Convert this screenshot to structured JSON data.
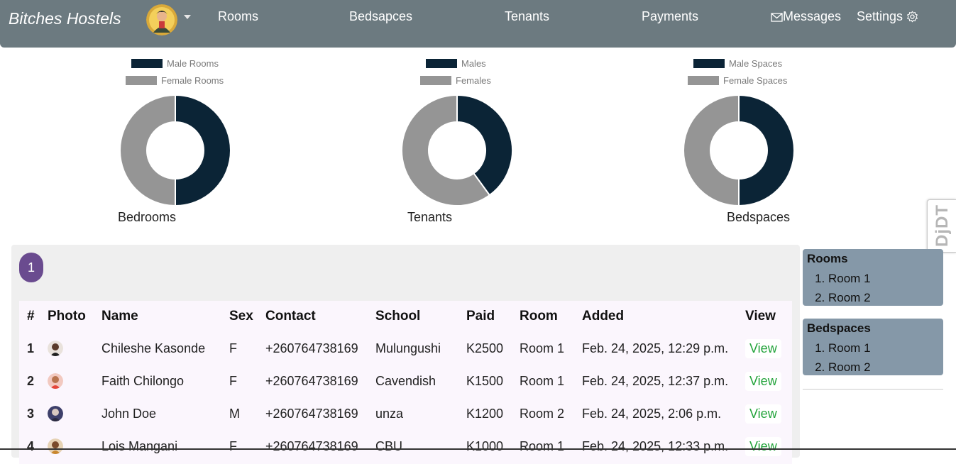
{
  "navbar": {
    "brand": "Bitches Hostels",
    "links": {
      "rooms": "Rooms",
      "bedspaces": "Bedsapces",
      "tenants": "Tenants",
      "payments": "Payments",
      "messages": "Messages",
      "settings": "Settings"
    }
  },
  "charts": [
    {
      "caption": "Bedrooms",
      "legend": [
        "Male Rooms",
        "Female Rooms"
      ],
      "values": [
        50,
        50
      ],
      "colors": [
        "#0b2436",
        "#959595"
      ]
    },
    {
      "caption": "Tenants",
      "legend": [
        "Males",
        "Females"
      ],
      "values": [
        40,
        60
      ],
      "colors": [
        "#0b2436",
        "#959595"
      ]
    },
    {
      "caption": "Bedspaces",
      "legend": [
        "Male Spaces",
        "Female Spaces"
      ],
      "values": [
        50,
        50
      ],
      "colors": [
        "#0b2436",
        "#959595"
      ]
    }
  ],
  "debug_toolbar": {
    "label": "DjDT"
  },
  "pagination": {
    "current_page": "1"
  },
  "table": {
    "headers": [
      "#",
      "Photo",
      "Name",
      "Sex",
      "Contact",
      "School",
      "Paid",
      "Room",
      "Added",
      "View"
    ],
    "rows": [
      {
        "num": "1",
        "name": "Chileshe Kasonde",
        "sex": "F",
        "contact": "+260764738169",
        "school": "Mulungushi",
        "paid": "K2500",
        "room": "Room 1",
        "added": "Feb. 24, 2025, 12:29 p.m.",
        "view": "View"
      },
      {
        "num": "2",
        "name": "Faith Chilongo",
        "sex": "F",
        "contact": "+260764738169",
        "school": "Cavendish",
        "paid": "K1500",
        "room": "Room 1",
        "added": "Feb. 24, 2025, 12:37 p.m.",
        "view": "View"
      },
      {
        "num": "3",
        "name": "John Doe",
        "sex": "M",
        "contact": "+260764738169",
        "school": "unza",
        "paid": "K1200",
        "room": "Room 2",
        "added": "Feb. 24, 2025, 2:06 p.m.",
        "view": "View"
      },
      {
        "num": "4",
        "name": "Lois Mangani",
        "sex": "F",
        "contact": "+260764738169",
        "school": "CBU",
        "paid": "K1000",
        "room": "Room 1",
        "added": "Feb. 24, 2025, 12:33 p.m.",
        "view": "View"
      }
    ]
  },
  "sidebar": {
    "rooms": {
      "title": "Rooms",
      "items": [
        "Room 1",
        "Room 2"
      ]
    },
    "bedspaces": {
      "title": "Bedspaces",
      "items": [
        "Room 1",
        "Room 2"
      ]
    }
  },
  "icons": {
    "messages": "envelope-icon",
    "settings": "gear-icon",
    "menu": "chevron-down-icon"
  },
  "colors": {
    "navbar": "#6c7a80",
    "male": "#0b2436",
    "female": "#959595",
    "pagination": "#6a4b8f",
    "view_link": "#22a33a",
    "sidebar": "#8598a8"
  }
}
